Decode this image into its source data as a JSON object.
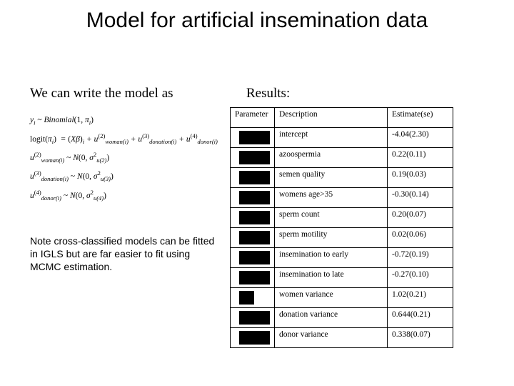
{
  "title": "Model for artificial insemination data",
  "left_intro": "We can write the model as",
  "results_label": "Results:",
  "note": "Note cross-classified models can be fitted in IGLS but are far easier to fit using MCMC estimation.",
  "formulas": {
    "line1_html": "y<span class='sub'>i</span> <span class='nrm'>~</span> Binomial<span class='nrm'>(1, </span>π<span class='sub'>i</span><span class='nrm'>)</span>",
    "line2_html": "<span class='nrm'>logit(</span>π<span class='sub'>i</span><span class='nrm'>)</span> &nbsp;= <span class='nrm'>(</span>Xβ<span class='nrm'>)</span><span class='sub'>i</span> + u<span class='sup'>(2)</span><span class='sub'>woman(i)</span> + u<span class='sup'>(3)</span><span class='sub'>donation(i)</span> + u<span class='sup'>(4)</span><span class='sub'>donor(i)</span>",
    "line3_html": "u<span class='sup'>(2)</span><span class='sub'>woman(i)</span> <span class='nrm'>~</span> N<span class='nrm'>(0, </span>σ<span class='sup'>2</span><span class='sub'>u(2)</span><span class='nrm'>)</span>",
    "line4_html": "u<span class='sup'>(3)</span><span class='sub'>donation(i)</span> <span class='nrm'>~</span> N<span class='nrm'>(0, </span>σ<span class='sup'>2</span><span class='sub'>u(3)</span><span class='nrm'>)</span>",
    "line5_html": "u<span class='sup'>(4)</span><span class='sub'>donor(i)</span> <span class='nrm'>~</span> N<span class='nrm'>(0, </span>σ<span class='sup'>2</span><span class='sub'>u(4)</span><span class='nrm'>)</span>"
  },
  "table": {
    "headers": {
      "param": "Parameter",
      "desc": "Description",
      "est": "Estimate(se)"
    },
    "rows": [
      {
        "desc": "intercept",
        "est": "-4.04(2.30)",
        "box": "wide"
      },
      {
        "desc": "azoospermia",
        "est": "0.22(0.11)",
        "box": "wide"
      },
      {
        "desc": "semen quality",
        "est": "0.19(0.03)",
        "box": "wide"
      },
      {
        "desc": "womens age>35",
        "est": "-0.30(0.14)",
        "box": "wide"
      },
      {
        "desc": "sperm count",
        "est": "0.20(0.07)",
        "box": "wide"
      },
      {
        "desc": "sperm motility",
        "est": "0.02(0.06)",
        "box": "wide"
      },
      {
        "desc": "insemination to early",
        "est": "-0.72(0.19)",
        "box": "wide"
      },
      {
        "desc": "insemination to late",
        "est": "-0.27(0.10)",
        "box": "wide"
      },
      {
        "desc": "women variance",
        "est": "1.02(0.21)",
        "box": "narrow"
      },
      {
        "desc": "donation variance",
        "est": "0.644(0.21)",
        "box": "wide"
      },
      {
        "desc": "donor variance",
        "est": "0.338(0.07)",
        "box": "wide"
      }
    ]
  }
}
